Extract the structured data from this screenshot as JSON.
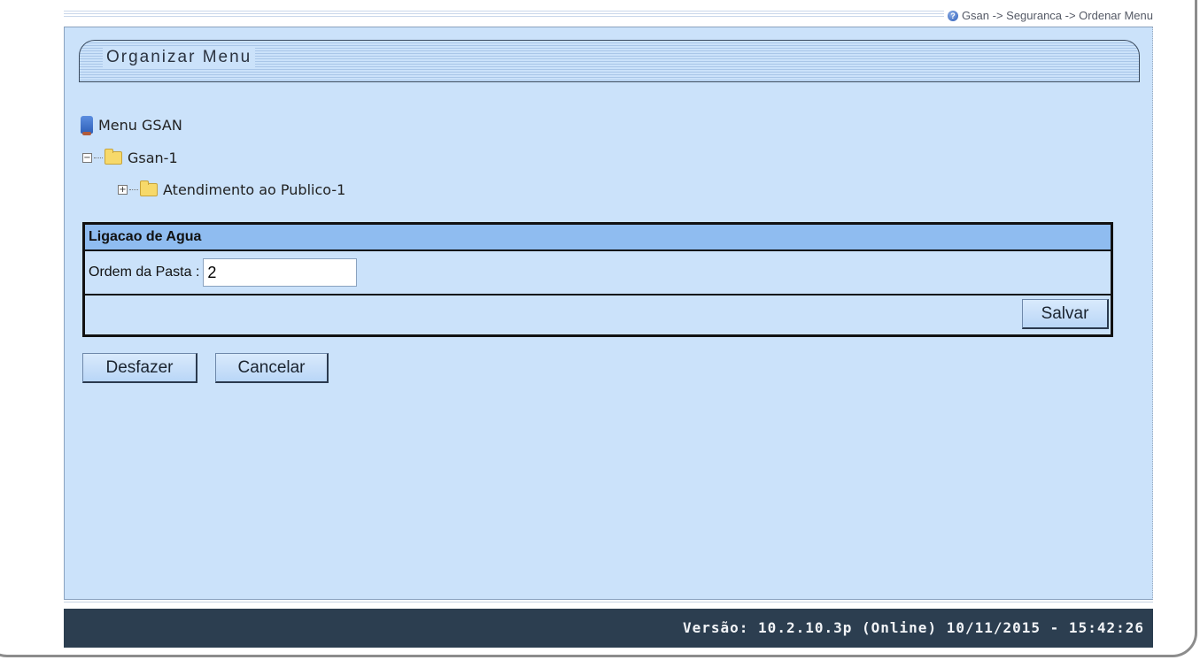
{
  "breadcrumb": "Gsan -> Seguranca -> Ordenar Menu",
  "panel_title": "Organizar Menu",
  "tree": {
    "root": "Menu GSAN",
    "level1": "Gsan-1",
    "level2": "Atendimento ao Publico-1",
    "level1_expander": "−",
    "level2_expander": "+"
  },
  "form": {
    "header": "Ligacao de Agua",
    "order_label": "Ordem da Pasta :",
    "order_value": "2",
    "save_label": "Salvar"
  },
  "actions": {
    "undo_label": "Desfazer",
    "cancel_label": "Cancelar"
  },
  "footer": "Versão: 10.2.10.3p (Online) 10/11/2015 - 15:42:26",
  "icons": {
    "help": "help-icon",
    "root": "computer-icon",
    "folder_open": "folder-open-icon",
    "folder_closed": "folder-icon"
  },
  "colors": {
    "panel_bg": "#cbe2fa",
    "form_header_bg": "#8fbcf0",
    "footer_bg": "#2c3e50"
  }
}
